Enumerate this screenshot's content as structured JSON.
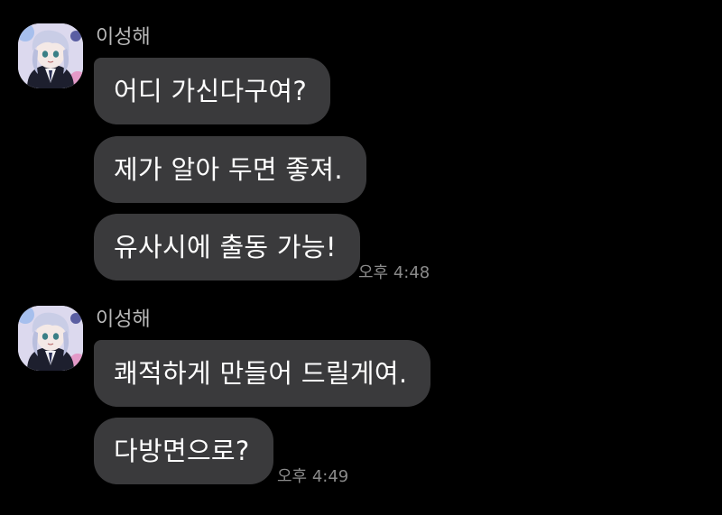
{
  "groups": [
    {
      "sender": "이성해",
      "messages": [
        "어디 가신다구여?",
        "제가 알아 두면 좋져.",
        "유사시에 출동 가능!"
      ],
      "time": "오후 4:48"
    },
    {
      "sender": "이성해",
      "messages": [
        "쾌적하게 만들어 드릴게여.",
        "다방면으로?"
      ],
      "time": "오후 4:49"
    }
  ],
  "colors": {
    "background": "#000000",
    "bubble": "#3a3a3c",
    "sender_text": "#b9b9b9",
    "time_text": "#8a8a8a",
    "message_text": "#ffffff"
  },
  "icons": {
    "avatar": "anime-character-avatar"
  }
}
